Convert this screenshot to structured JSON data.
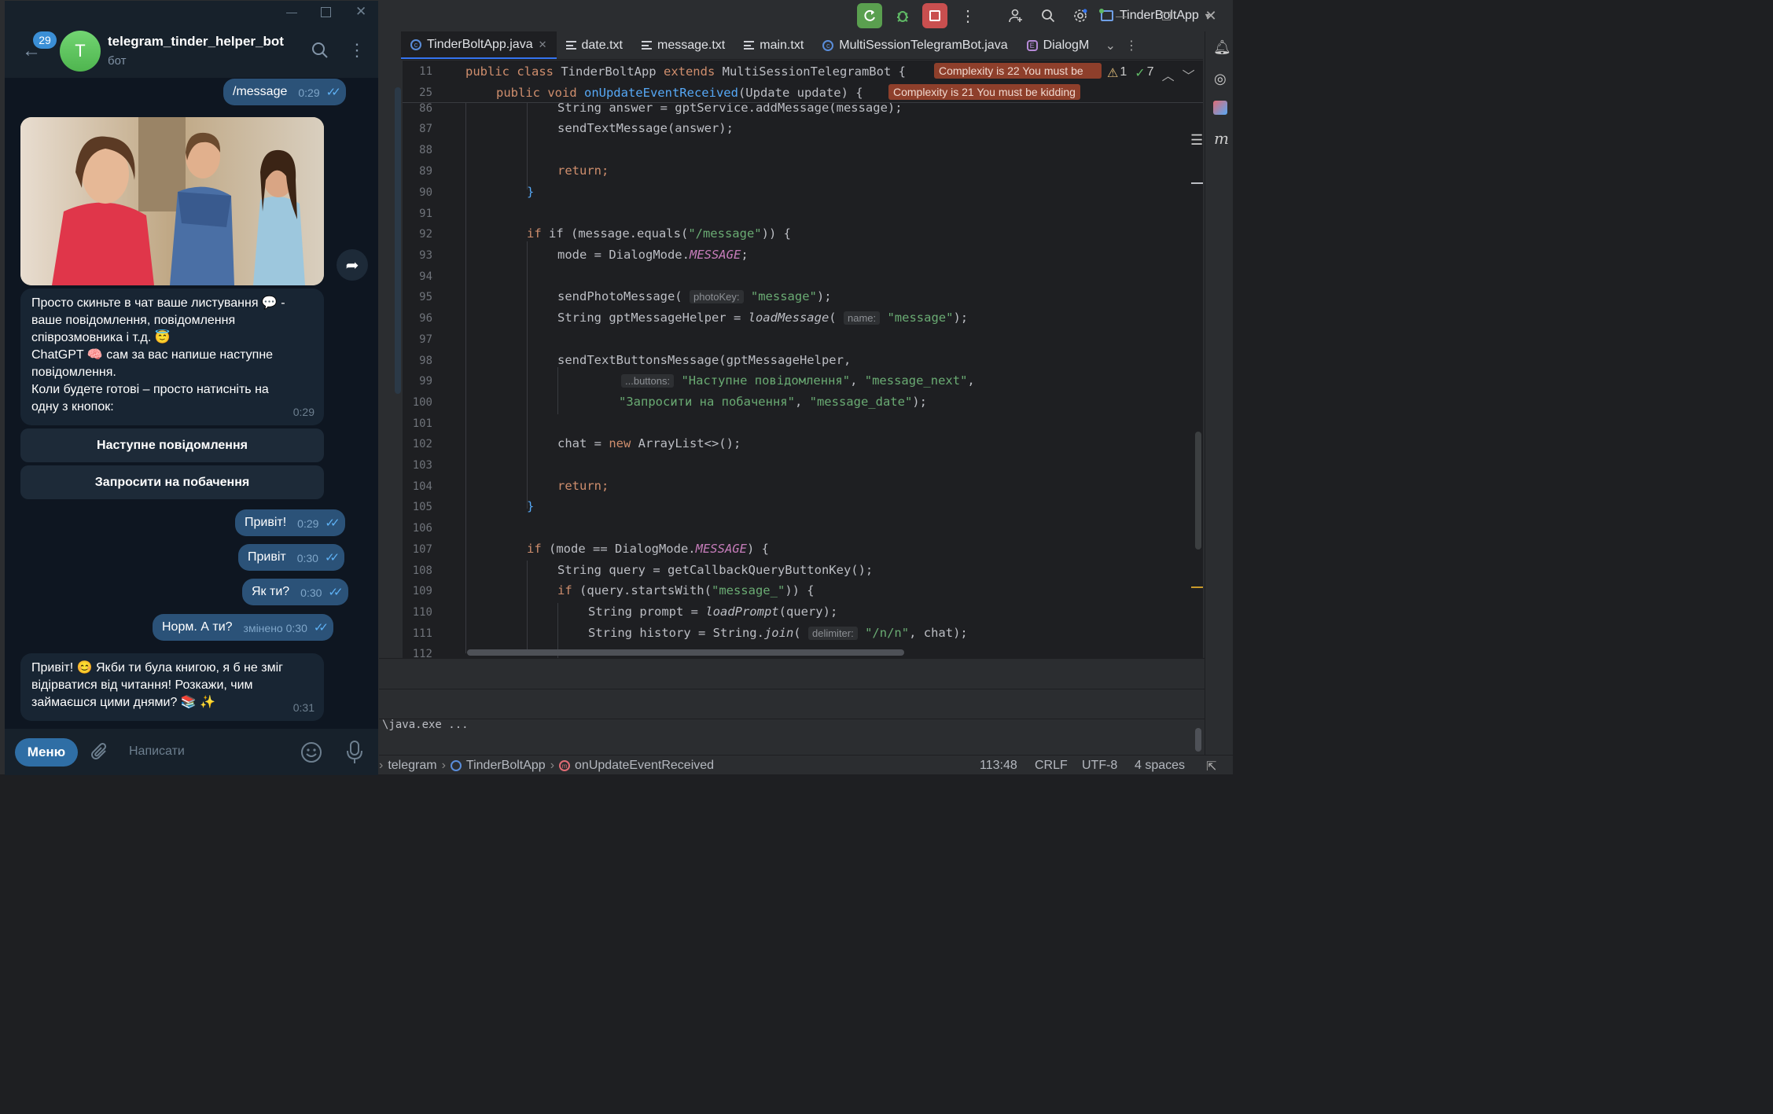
{
  "ide": {
    "run_config": "TinderBoltApp",
    "tabs": [
      {
        "label": "TinderBoltApp.java",
        "icon": "class-icon"
      },
      {
        "label": "date.txt",
        "icon": "text-file-icon"
      },
      {
        "label": "message.txt",
        "icon": "text-file-icon"
      },
      {
        "label": "main.txt",
        "icon": "text-file-icon"
      },
      {
        "label": "MultiSessionTelegramBot.java",
        "icon": "class-icon"
      },
      {
        "label": "DialogM",
        "icon": "enum-icon"
      }
    ],
    "inspections": {
      "warnings": "1",
      "ok": "7"
    },
    "sticky": [
      {
        "line": "11",
        "code": "public class TinderBoltApp extends MultiSessionTelegramBot {",
        "complexity": "Complexity is 22 You must be"
      },
      {
        "line": "25",
        "code": "public void onUpdateEventReceived(Update update) {",
        "complexity": "Complexity is 21 You must be kidding"
      }
    ],
    "line_numbers": [
      "86",
      "87",
      "88",
      "89",
      "90",
      "91",
      "92",
      "93",
      "94",
      "95",
      "96",
      "97",
      "98",
      "99",
      "100",
      "101",
      "102",
      "103",
      "104",
      "105",
      "106",
      "107",
      "108",
      "109",
      "110",
      "111",
      "112"
    ],
    "code": {
      "l86": "String answer = gptService.addMessage(message);",
      "l87": "sendTextMessage(answer);",
      "l89": "return;",
      "l90": "}",
      "l92a": "if (message.equals(",
      "l92b": "\"/message\"",
      "l92c": ")) {",
      "l93a": "mode = DialogMode.",
      "l93b": "MESSAGE",
      "l93c": ";",
      "l95a": "sendPhotoMessage(",
      "l95hint": "photoKey:",
      "l95b": "\"message\"",
      "l95c": ");",
      "l96a": "String gptMessageHelper = ",
      "l96fn": "loadMessage",
      "l96p": "(",
      "l96hint": "name:",
      "l96b": "\"message\"",
      "l96c": ");",
      "l98": "sendTextButtonsMessage(gptMessageHelper,",
      "l99hint": "...buttons:",
      "l99a": "\"Наступне повідомлення\"",
      "l99sep": ", ",
      "l99b": "\"message_next\"",
      "l99c": ",",
      "l100a": "\"Запросити на побачення\"",
      "l100sep": ", ",
      "l100b": "\"message_date\"",
      "l100c": ");",
      "l102a": "chat = ",
      "l102kw": "new",
      "l102b": " ArrayList<>();",
      "l104": "return;",
      "l105": "}",
      "l107kw": "if",
      "l107a": " (mode == DialogMode.",
      "l107b": "MESSAGE",
      "l107c": ") {",
      "l108": "String query = getCallbackQueryButtonKey();",
      "l109kw": "if",
      "l109a": " (query.startsWith(",
      "l109b": "\"message_\"",
      "l109c": ")) {",
      "l110a": "String prompt = ",
      "l110fn": "loadPrompt",
      "l110b": "(query);",
      "l111a": "String history = String.",
      "l111fn": "join",
      "l111p": "(",
      "l111hint": "delimiter:",
      "l111b": "\"/n/n\"",
      "l111c": ", chat);"
    },
    "console": "\\java.exe ...",
    "status": {
      "crumb1": "telegram",
      "crumb2": "TinderBoltApp",
      "crumb3": "onUpdateEventReceived",
      "position": "113:48",
      "line_sep": "CRLF",
      "encoding": "UTF-8",
      "indent": "4 spaces"
    }
  },
  "telegram": {
    "unread_badge": "29",
    "avatar_letter": "T",
    "bot_name": "telegram_tinder_helper_bot",
    "bot_subtitle": "бот",
    "messages": {
      "m1": {
        "text": "/message",
        "time": "0:29"
      },
      "intro": {
        "lines": [
          "Просто скиньте в чат ваше листування 💬 -",
          "ваше повідомлення, повідомлення",
          "співрозмовника і т.д. 😇",
          "ChatGPT 🧠 сам за вас напише наступне",
          "повідомлення.",
          "Коли будете готові – просто натисніть на",
          "одну з кнопок:"
        ],
        "time": "0:29"
      },
      "btn1": "Наступне повідомлення",
      "btn2": "Запросити на побачення",
      "m2": {
        "text": "Привіт!",
        "time": "0:29"
      },
      "m3": {
        "text": "Привіт",
        "time": "0:30"
      },
      "m4": {
        "text": "Як ти?",
        "time": "0:30"
      },
      "m5": {
        "text": "Норм. А ти?",
        "time": "змінено 0:30"
      },
      "reply": {
        "lines": [
          "Привіт! 😊 Якби ти була книгою, я б не зміг",
          "відірватися від читання! Розкажи, чим",
          "займаєшся цими днями? 📚 ✨"
        ],
        "time": "0:31"
      }
    },
    "menu_label": "Меню",
    "input_placeholder": "Написати"
  },
  "colors": {
    "accent": "#3574f0",
    "complexity_bg": "#8e3f2b",
    "tg_out_bubble": "#2b5278",
    "tg_in_bubble": "#182533"
  }
}
